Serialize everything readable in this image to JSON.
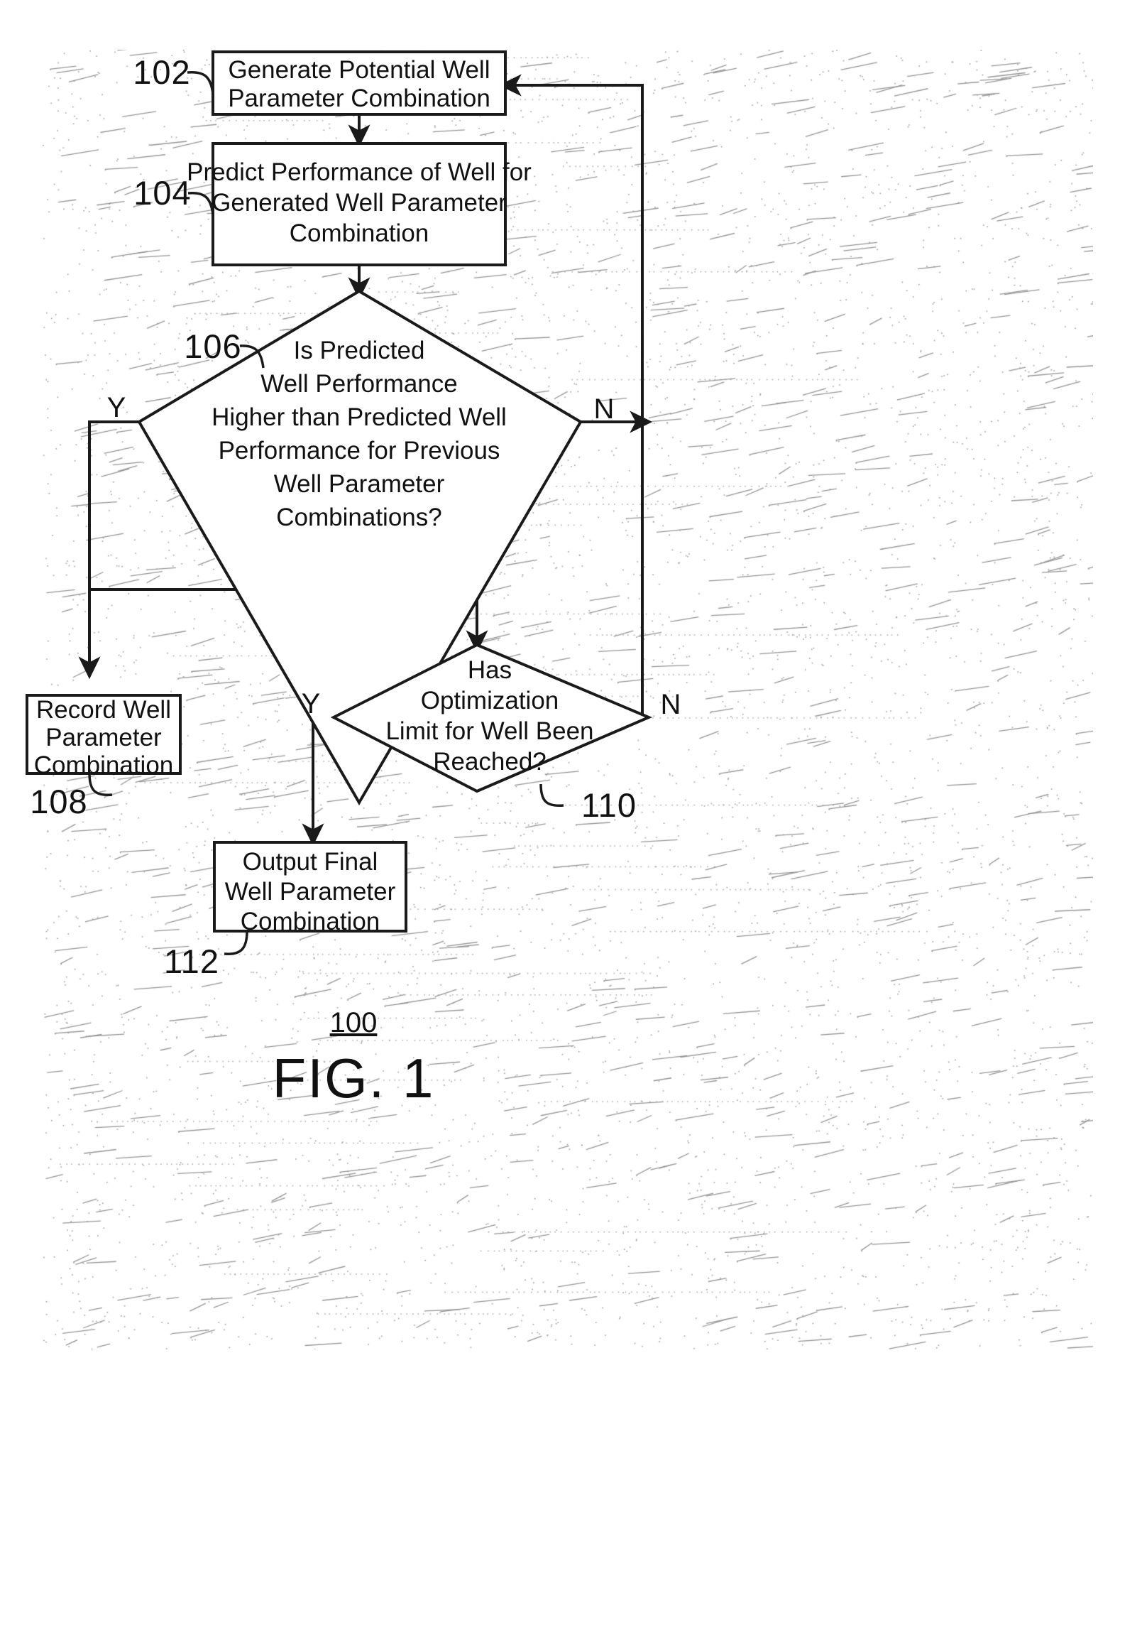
{
  "figure": {
    "number_label": "100",
    "caption": "FIG. 1"
  },
  "nodes": {
    "n102": {
      "ref": "102",
      "type": "process",
      "lines": [
        "Generate Potential Well",
        "Parameter Combination"
      ]
    },
    "n104": {
      "ref": "104",
      "type": "process",
      "lines": [
        "Predict Performance of Well for",
        "Generated Well Parameter",
        "Combination"
      ]
    },
    "n106": {
      "ref": "106",
      "type": "decision",
      "lines": [
        "Is Predicted",
        "Well Performance",
        "Higher than Predicted Well",
        "Performance for Previous",
        "Well Parameter",
        "Combinations?"
      ],
      "yes_label": "Y",
      "no_label": "N"
    },
    "n108": {
      "ref": "108",
      "type": "process",
      "lines": [
        "Record Well",
        "Parameter",
        "Combination"
      ]
    },
    "n110": {
      "ref": "110",
      "type": "decision",
      "lines": [
        "Has",
        "Optimization",
        "Limit for Well Been",
        "Reached?"
      ],
      "yes_label": "Y",
      "no_label": "N"
    },
    "n112": {
      "ref": "112",
      "type": "process",
      "lines": [
        "Output Final",
        "Well Parameter",
        "Combination"
      ]
    }
  },
  "colors": {
    "ink": "#1a1a1a",
    "paper": "#ffffff"
  }
}
